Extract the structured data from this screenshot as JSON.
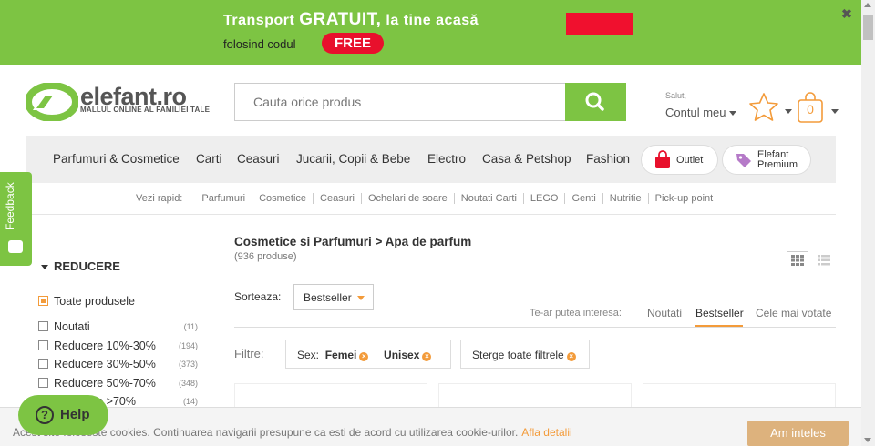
{
  "promo": {
    "line1_pre": "Transport",
    "line1_big": "GRATUIT,",
    "line1_post": "la tine acasă",
    "line2": "folosind codul",
    "code": "FREE",
    "close": "✖"
  },
  "header": {
    "logo_name": "elefant.ro",
    "logo_tagline": "MALLUL ONLINE AL FAMILIEI TALE",
    "search_placeholder": "Cauta orice produs",
    "greeting": "Salut,",
    "account": "Contul meu",
    "cart_count": "0"
  },
  "catnav": {
    "items": [
      "Parfumuri & Cosmetice",
      "Carti",
      "Ceasuri",
      "Jucarii, Copii & Bebe",
      "Electro",
      "Casa & Petshop",
      "Fashion"
    ],
    "outlet": "Outlet",
    "premium_1": "Elefant",
    "premium_2": "Premium"
  },
  "quick": {
    "label": "Vezi rapid:",
    "links": [
      "Parfumuri",
      "Cosmetice",
      "Ceasuri",
      "Ochelari de soare",
      "Noutati Carti",
      "LEGO",
      "Genti",
      "Nutritie",
      "Pick-up point"
    ]
  },
  "sidebar": {
    "feedback": "Feedback",
    "title": "REDUCERE",
    "all": "Toate produsele",
    "rows": [
      {
        "label": "Noutati",
        "count": "(11)"
      },
      {
        "label": "Reducere 10%-30%",
        "count": "(194)"
      },
      {
        "label": "Reducere 30%-50%",
        "count": "(373)"
      },
      {
        "label": "Reducere 50%-70%",
        "count": "(348)"
      },
      {
        "label": "Reducere >70%",
        "count": "(14)"
      }
    ]
  },
  "main": {
    "breadcrumb": "Cosmetice si Parfumuri > Apa de parfum",
    "count": "(936 produse)",
    "sort_label": "Sorteaza:",
    "sort_value": "Bestseller",
    "interest_label": "Te-ar putea interesa:",
    "tabs": [
      "Noutati",
      "Bestseller",
      "Cele mai votate"
    ],
    "filter_label": "Filtre:",
    "filter_sex": "Sex:",
    "filter_f": "Femei",
    "filter_u": "Unisex",
    "filter_clear": "Sterge toate filtrele"
  },
  "cookie": {
    "message": "Acest site foloseste cookies. Continuarea navigarii presupune ca esti de acord cu utilizarea cookie-urilor.",
    "link": "Afla detalii",
    "accept": "Am inteles"
  },
  "help": {
    "label": "Help",
    "icon_glyph": "?"
  },
  "colors": {
    "brand_green": "#7dc443",
    "accent_orange": "#f39b3a",
    "promo_red": "#e8102c"
  }
}
